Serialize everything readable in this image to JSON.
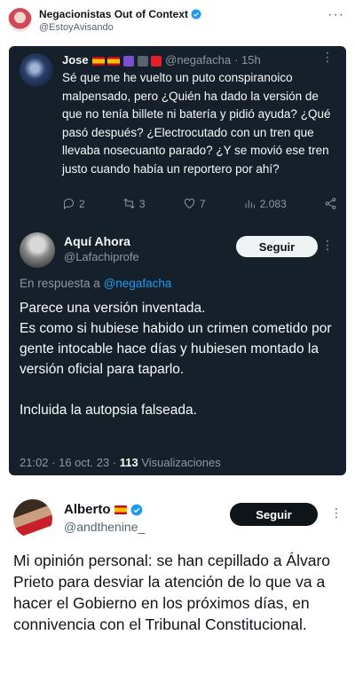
{
  "header": {
    "name": "Negacionistas Out of Context",
    "handle": "@EstoyAvisando",
    "more": "···"
  },
  "quoted": {
    "name": "Jose",
    "handle": "@negafacha",
    "time": "· 15h",
    "more": "⋮",
    "text": "Sé que me he vuelto un puto conspiranoico malpensado, pero ¿Quién ha dado la versión de que no tenía billete ni batería y pidió ayuda? ¿Qué pasó después? ¿Electrocutado con un tren que llevaba nosecuanto parado? ¿Y se movió ese tren justo cuando había un reportero por ahí?",
    "replies": "2",
    "retweets": "3",
    "likes": "7",
    "views": "2.083"
  },
  "reply": {
    "name": "Aquí Ahora",
    "handle": "@Lafachiprofe",
    "follow_label": "Seguir",
    "more": "⋮",
    "in_reply_prefix": "En respuesta a",
    "in_reply_handle": "@negafacha",
    "lines": [
      "Parece una versión inventada.",
      "Es como si hubiese habido un crimen cometido por gente intocable hace días y hubiesen montado la versión oficial para taparlo."
    ],
    "last_line": "Incluida la autopsia falseada.",
    "timestamp": "21:02 · 16 oct. 23 ·",
    "views_count": "113",
    "views_label": "Visualizaciones"
  },
  "alberto": {
    "name": "Alberto",
    "handle": "@andthenine_",
    "follow_label": "Seguir",
    "more": "⋮",
    "text": "Mi opinión personal: se han cepillado a Álvaro Prieto para desviar la atención de lo que va a hacer el Gobierno en los próximos días, en connivencia con el Tribunal Constitucional."
  }
}
